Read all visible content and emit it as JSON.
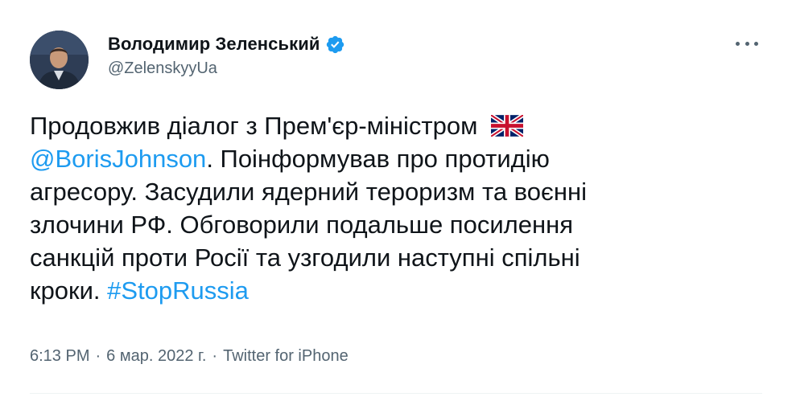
{
  "author": {
    "display_name": "Володимир Зеленський",
    "handle": "@ZelenskyyUa",
    "verified": true
  },
  "tweet": {
    "lines": [
      {
        "segments": [
          {
            "text": "Продовжив діалог з Прем'єр-міністром",
            "type": "text"
          }
        ],
        "flag": "uk-flag"
      },
      {
        "segments": [
          {
            "text": "@BorisJohnson",
            "type": "mention"
          },
          {
            "text": ". Поінформував про протидію",
            "type": "text"
          }
        ]
      },
      {
        "segments": [
          {
            "text": "агресору. Засудили ядерний тероризм та воєнні",
            "type": "text"
          }
        ]
      },
      {
        "segments": [
          {
            "text": "злочини РФ. Обговорили подальше посилення",
            "type": "text"
          }
        ]
      },
      {
        "segments": [
          {
            "text": "санкцій проти Росії та узгодили наступні спільні",
            "type": "text"
          }
        ]
      },
      {
        "segments": [
          {
            "text": "кроки. ",
            "type": "text"
          },
          {
            "text": "#StopRussia",
            "type": "hashtag"
          }
        ]
      }
    ]
  },
  "meta": {
    "time": "6:13 PM",
    "date": "6 мар. 2022 г.",
    "separator": "·",
    "source": "Twitter for iPhone"
  },
  "icons": {
    "verified": "verified-badge-icon",
    "more": "more-options-icon",
    "flag": "uk-flag-icon"
  },
  "colors": {
    "link": "#1d9bf0",
    "text": "#0f1419",
    "secondary": "#536471",
    "verified": "#1d9bf0"
  }
}
